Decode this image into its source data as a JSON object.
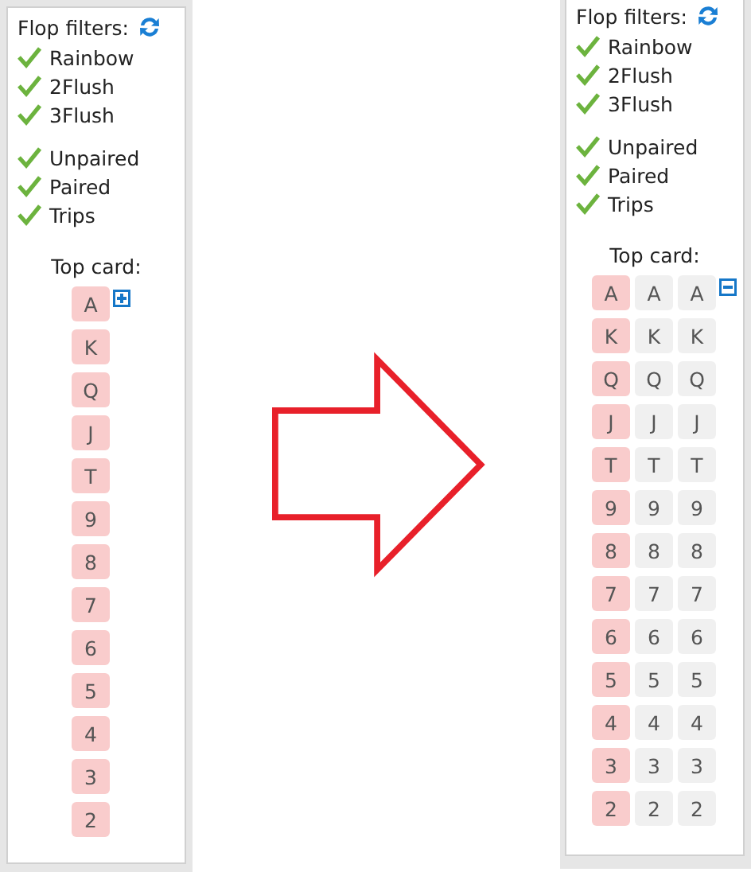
{
  "panels": [
    {
      "title": "Flop filters:",
      "filter_groups": [
        [
          {
            "label": "Rainbow",
            "checked": true
          },
          {
            "label": "2Flush",
            "checked": true
          },
          {
            "label": "3Flush",
            "checked": true
          }
        ],
        [
          {
            "label": "Unpaired",
            "checked": true
          },
          {
            "label": "Paired",
            "checked": true
          },
          {
            "label": "Trips",
            "checked": true
          }
        ]
      ],
      "top_card_label": "Top card:",
      "expanded": false,
      "rows": [
        {
          "cards": [
            {
              "rank": "A",
              "selected": true
            }
          ]
        },
        {
          "cards": [
            {
              "rank": "K",
              "selected": true
            }
          ]
        },
        {
          "cards": [
            {
              "rank": "Q",
              "selected": true
            }
          ]
        },
        {
          "cards": [
            {
              "rank": "J",
              "selected": true
            }
          ]
        },
        {
          "cards": [
            {
              "rank": "T",
              "selected": true
            }
          ]
        },
        {
          "cards": [
            {
              "rank": "9",
              "selected": true
            }
          ]
        },
        {
          "cards": [
            {
              "rank": "8",
              "selected": true
            }
          ]
        },
        {
          "cards": [
            {
              "rank": "7",
              "selected": true
            }
          ]
        },
        {
          "cards": [
            {
              "rank": "6",
              "selected": true
            }
          ]
        },
        {
          "cards": [
            {
              "rank": "5",
              "selected": true
            }
          ]
        },
        {
          "cards": [
            {
              "rank": "4",
              "selected": true
            }
          ]
        },
        {
          "cards": [
            {
              "rank": "3",
              "selected": true
            }
          ]
        },
        {
          "cards": [
            {
              "rank": "2",
              "selected": true
            }
          ]
        }
      ]
    },
    {
      "title": "Flop filters:",
      "filter_groups": [
        [
          {
            "label": "Rainbow",
            "checked": true
          },
          {
            "label": "2Flush",
            "checked": true
          },
          {
            "label": "3Flush",
            "checked": true
          }
        ],
        [
          {
            "label": "Unpaired",
            "checked": true
          },
          {
            "label": "Paired",
            "checked": true
          },
          {
            "label": "Trips",
            "checked": true
          }
        ]
      ],
      "top_card_label": "Top card:",
      "expanded": true,
      "rows": [
        {
          "cards": [
            {
              "rank": "A",
              "selected": true
            },
            {
              "rank": "A",
              "selected": false
            },
            {
              "rank": "A",
              "selected": false
            }
          ]
        },
        {
          "cards": [
            {
              "rank": "K",
              "selected": true
            },
            {
              "rank": "K",
              "selected": false
            },
            {
              "rank": "K",
              "selected": false
            }
          ]
        },
        {
          "cards": [
            {
              "rank": "Q",
              "selected": true
            },
            {
              "rank": "Q",
              "selected": false
            },
            {
              "rank": "Q",
              "selected": false
            }
          ]
        },
        {
          "cards": [
            {
              "rank": "J",
              "selected": true
            },
            {
              "rank": "J",
              "selected": false
            },
            {
              "rank": "J",
              "selected": false
            }
          ]
        },
        {
          "cards": [
            {
              "rank": "T",
              "selected": true
            },
            {
              "rank": "T",
              "selected": false
            },
            {
              "rank": "T",
              "selected": false
            }
          ]
        },
        {
          "cards": [
            {
              "rank": "9",
              "selected": true
            },
            {
              "rank": "9",
              "selected": false
            },
            {
              "rank": "9",
              "selected": false
            }
          ]
        },
        {
          "cards": [
            {
              "rank": "8",
              "selected": true
            },
            {
              "rank": "8",
              "selected": false
            },
            {
              "rank": "8",
              "selected": false
            }
          ]
        },
        {
          "cards": [
            {
              "rank": "7",
              "selected": true
            },
            {
              "rank": "7",
              "selected": false
            },
            {
              "rank": "7",
              "selected": false
            }
          ]
        },
        {
          "cards": [
            {
              "rank": "6",
              "selected": true
            },
            {
              "rank": "6",
              "selected": false
            },
            {
              "rank": "6",
              "selected": false
            }
          ]
        },
        {
          "cards": [
            {
              "rank": "5",
              "selected": true
            },
            {
              "rank": "5",
              "selected": false
            },
            {
              "rank": "5",
              "selected": false
            }
          ]
        },
        {
          "cards": [
            {
              "rank": "4",
              "selected": true
            },
            {
              "rank": "4",
              "selected": false
            },
            {
              "rank": "4",
              "selected": false
            }
          ]
        },
        {
          "cards": [
            {
              "rank": "3",
              "selected": true
            },
            {
              "rank": "3",
              "selected": false
            },
            {
              "rank": "3",
              "selected": false
            }
          ]
        },
        {
          "cards": [
            {
              "rank": "2",
              "selected": true
            },
            {
              "rank": "2",
              "selected": false
            },
            {
              "rank": "2",
              "selected": false
            }
          ]
        }
      ]
    }
  ]
}
